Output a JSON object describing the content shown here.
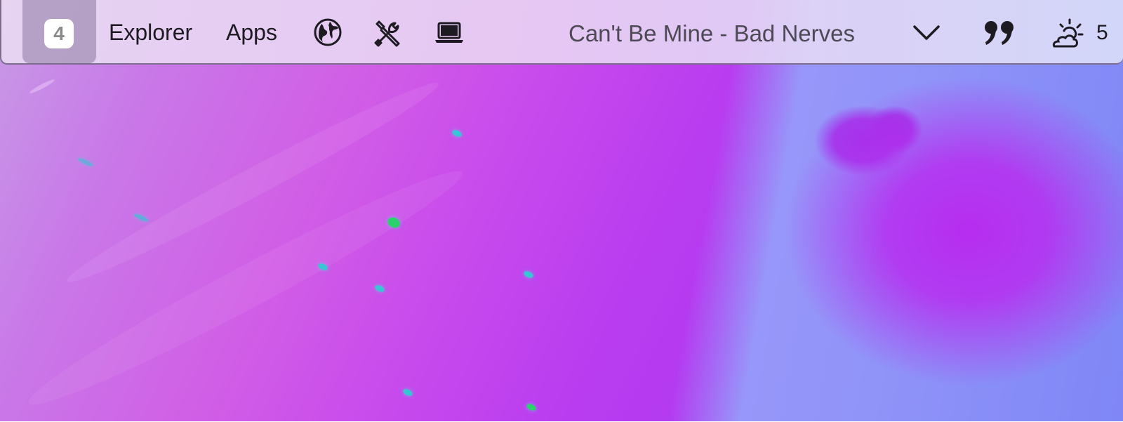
{
  "menubar": {
    "workspace": {
      "number": "4",
      "icon": "workspace-badge"
    },
    "items": [
      {
        "label": "Explorer"
      },
      {
        "label": "Apps"
      }
    ],
    "icons": [
      "globe-icon",
      "tools-icon",
      "laptop-icon"
    ],
    "now_playing": "Can't Be Mine - Bad Nerves",
    "right_icons": [
      "chevron-down-icon",
      "quote-icon",
      "weather-cloud-sun-icon"
    ],
    "weather_partial": "5"
  },
  "colors": {
    "menubar_bg": "#e6d4f2",
    "workspace_bg": "#8c78a0",
    "text": "#1d1a22",
    "muted_text": "#4d4a55"
  }
}
